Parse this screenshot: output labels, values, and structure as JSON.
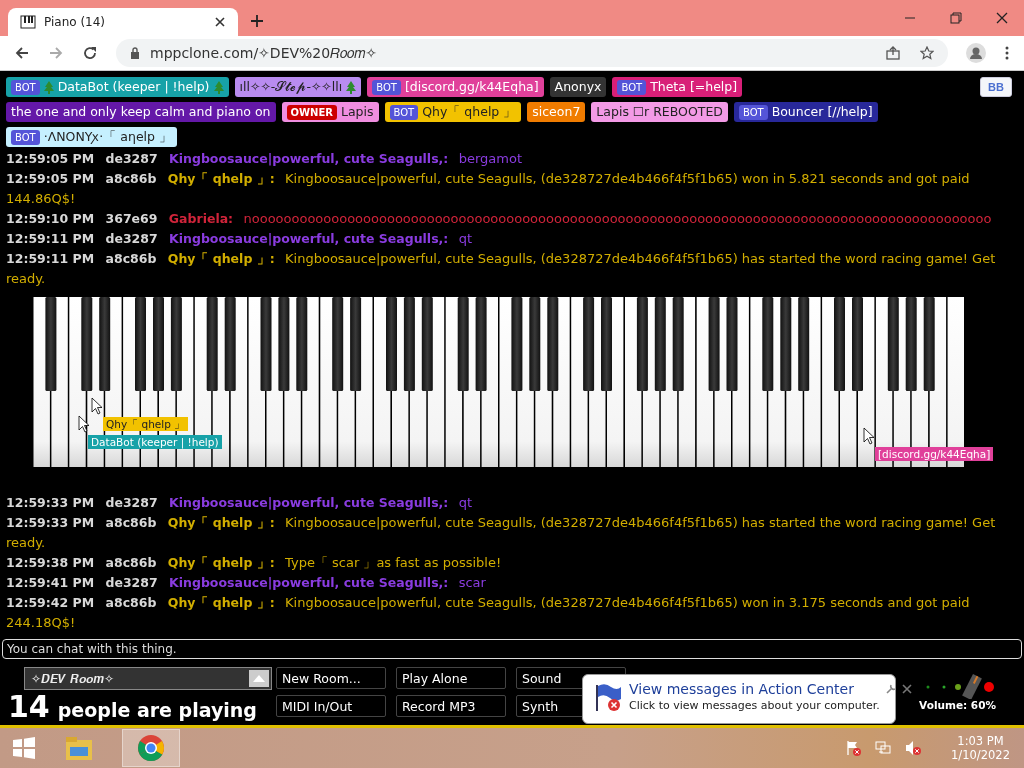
{
  "browser": {
    "tab_title": "Piano (14)",
    "url": "mppclone.com/✧DEV%20𝑅𝑜𝑜𝑚✧"
  },
  "user_rows": [
    {
      "tags": [
        {
          "badge": {
            "text": "BOT",
            "kind": "bot"
          },
          "name": "DataBot (keeper | !help)",
          "kind": "trees",
          "color": "#17a2a8"
        },
        {
          "name": "ıll✧✧-𝓢𝓽𝓮𝓹-✧✧llı",
          "kind": "tree_suffix",
          "color": "#b98cf0"
        },
        {
          "badge": {
            "text": "BOT",
            "kind": "bot"
          },
          "name": "[discord.gg/k44Eqha]",
          "color": "#e0409a"
        },
        {
          "name": "Anonyx",
          "color": "#333333"
        },
        {
          "badge": {
            "text": "BOT",
            "kind": "bot"
          },
          "name": "Theta [=help]",
          "color": "#d81f78"
        }
      ]
    },
    {
      "tags": [
        {
          "name": "the one and only keep calm and piano on",
          "color": "#6418a8"
        },
        {
          "badge": {
            "text": "OWNER",
            "kind": "owner"
          },
          "name": "Lapis",
          "color": "#f08ee0"
        },
        {
          "badge": {
            "text": "BOT",
            "kind": "bot"
          },
          "name": "Qhy「 qhelp 」",
          "color": "#f2c200"
        },
        {
          "name": "siceon7",
          "color": "#f07c00"
        },
        {
          "name": "Lapis ☐r REBOOTED",
          "color": "#f39ae6"
        },
        {
          "badge": {
            "text": "BOT",
            "kind": "bot"
          },
          "name": "Bouncer [//help]",
          "color": "#28289a"
        }
      ]
    },
    {
      "tags": [
        {
          "badge": {
            "text": "BOT",
            "kind": "bot"
          },
          "name": "·ΛΝΟΝΥꭗ·「 aηelp 」",
          "color": "#c6f0ff"
        }
      ]
    }
  ],
  "toggle_button": "BB",
  "chat_upper": [
    {
      "time": "12:59:05 PM",
      "id": "de3287",
      "name": "Kingboosauce|powerful, cute Seagulls,:",
      "message": "bergamot",
      "color": "#8a3ce0"
    },
    {
      "time": "12:59:05 PM",
      "id": "a8c86b",
      "name": "Qhy「 qhelp 」:",
      "message": "Kingboosauce|powerful, cute Seagulls, (de328727de4b466f4f5f1b65) won in 5.821 seconds and got paid 144.86Q$!",
      "color": "#d2ae00"
    },
    {
      "time": "12:59:10 PM",
      "id": "367e69",
      "name": "Gabriela:",
      "message": "nooooooooooooooooooooooooooooooooooooooooooooooooooooooooooooooooooooooooooooooooooooooooooooo",
      "color": "#d0243a"
    },
    {
      "time": "12:59:11 PM",
      "id": "de3287",
      "name": "Kingboosauce|powerful, cute Seagulls,:",
      "message": "qt",
      "color": "#8a3ce0"
    },
    {
      "time": "12:59:11 PM",
      "id": "a8c86b",
      "name": "Qhy「 qhelp 」:",
      "message": "Kingboosauce|powerful, cute Seagulls, (de328727de4b466f4f5f1b65) has started the word racing game! Get ready.",
      "color": "#d2ae00"
    }
  ],
  "cursor_labels": [
    {
      "text": "Qhy「 qhelp 」",
      "color": "#f2c200"
    },
    {
      "text": "DataBot (keeper | !help)",
      "color": "#17a2a8"
    },
    {
      "text": "[discord.gg/k44Eqha]",
      "color": "#e0409a"
    }
  ],
  "chat_lower": [
    {
      "time": "12:59:33 PM",
      "id": "de3287",
      "name": "Kingboosauce|powerful, cute Seagulls,:",
      "message": "qt",
      "color": "#8a3ce0"
    },
    {
      "time": "12:59:33 PM",
      "id": "a8c86b",
      "name": "Qhy「 qhelp 」:",
      "message": "Kingboosauce|powerful, cute Seagulls, (de328727de4b466f4f5f1b65) has started the word racing game! Get ready.",
      "color": "#d2ae00"
    },
    {
      "time": "12:59:38 PM",
      "id": "a8c86b",
      "name": "Qhy「 qhelp 」:",
      "message": "Type「 scar 」as fast as possible!",
      "color": "#d2ae00"
    },
    {
      "time": "12:59:41 PM",
      "id": "de3287",
      "name": "Kingboosauce|powerful, cute Seagulls,:",
      "message": "scar",
      "color": "#8a3ce0"
    },
    {
      "time": "12:59:42 PM",
      "id": "a8c86b",
      "name": "Qhy「 qhelp 」:",
      "message": "Kingboosauce|powerful, cute Seagulls, (de328727de4b466f4f5f1b65) won in 3.175 seconds and got paid 244.18Q$!",
      "color": "#d2ae00"
    }
  ],
  "chat_input": {
    "placeholder": "You can chat with this thing."
  },
  "room": {
    "name": "✧𝑫𝑬𝑽 𝑹𝒐𝒐𝒎✧"
  },
  "player_count": "14",
  "player_label": "people are playing",
  "buttons": [
    "New Room...",
    "Play Alone",
    "Sound",
    "MIDI In/Out",
    "Record MP3",
    "Synth"
  ],
  "volume": {
    "label": "Volume: 60%"
  },
  "notification": {
    "title": "View messages in Action Center",
    "body": "Click to view messages about your computer."
  },
  "taskbar": {
    "time": "1:03 PM",
    "date": "1/10/2022"
  }
}
